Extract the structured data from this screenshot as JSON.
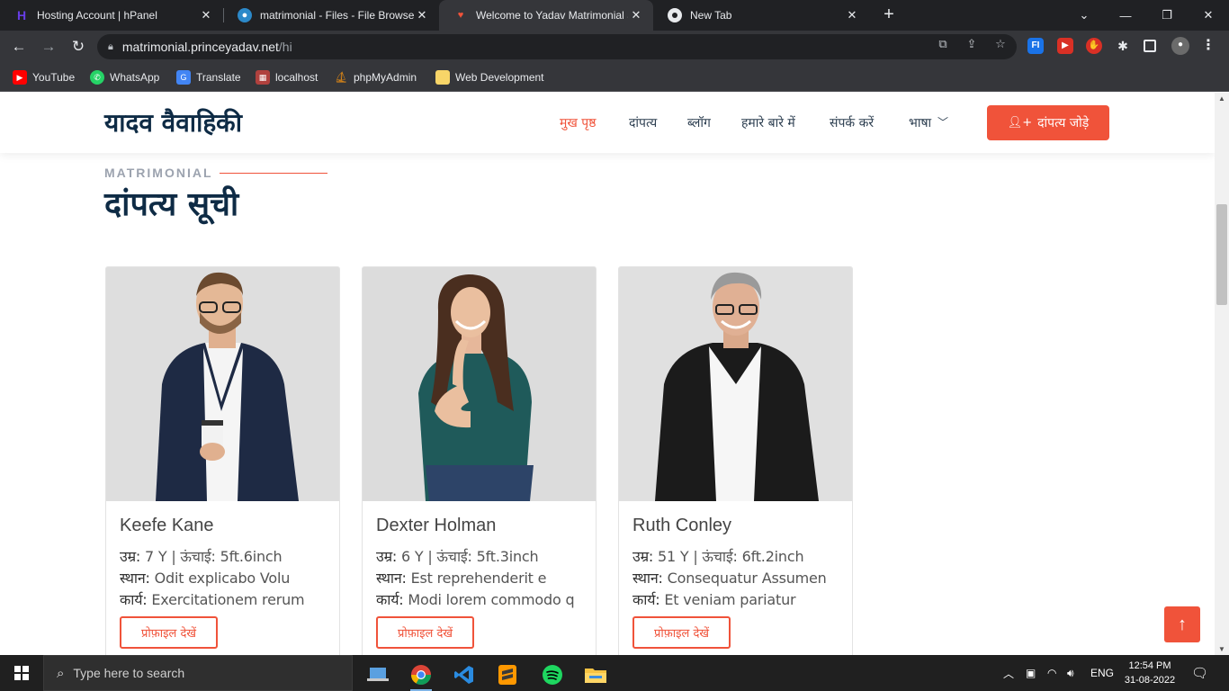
{
  "browser": {
    "tabs": [
      {
        "title": "Hosting Account | hPanel",
        "icon": "hostinger-icon",
        "active": false
      },
      {
        "title": "matrimonial - Files - File Browser",
        "icon": "file-browser-icon",
        "active": false
      },
      {
        "title": "Welcome to Yadav Matrimonial S",
        "icon": "site-icon",
        "active": true
      },
      {
        "title": "New Tab",
        "icon": "chrome-icon",
        "active": false
      }
    ],
    "url_host": "matrimonial.princeyadav.net",
    "url_path": "/hi",
    "bookmarks": [
      {
        "label": "YouTube",
        "icon": "youtube-icon"
      },
      {
        "label": "WhatsApp",
        "icon": "whatsapp-icon"
      },
      {
        "label": "Translate",
        "icon": "translate-icon"
      },
      {
        "label": "localhost",
        "icon": "localhost-icon"
      },
      {
        "label": "phpMyAdmin",
        "icon": "phpmyadmin-icon"
      },
      {
        "label": "Web Development",
        "icon": "folder-icon"
      }
    ]
  },
  "site": {
    "logo": "यादव वैवाहिकी",
    "nav": [
      {
        "label": "मुख पृष्ठ",
        "active": true
      },
      {
        "label": "दांपत्य",
        "active": false
      },
      {
        "label": "ब्लॉग",
        "active": false
      },
      {
        "label": "हमारे बारे में",
        "active": false
      },
      {
        "label": "संपर्क करें",
        "active": false
      },
      {
        "label": "भाषा",
        "active": false
      }
    ],
    "add_button": "दांपत्य जोड़े",
    "accent": "#f0533a",
    "heading_color": "#0e2b45"
  },
  "section": {
    "eyebrow": "MATRIMONIAL",
    "title": "दांपत्य सूची"
  },
  "profiles": [
    {
      "name": "Keefe Kane",
      "line1_label": "उम्र:",
      "line1_value": " 7 Y | ऊंचाई: 5ft.6inch",
      "line2_label": "स्थान:",
      "line2_value": " Odit explicabo Volu",
      "line3_label": "कार्य:",
      "line3_value": " Exercitationem rerum",
      "button": "प्रोफ़ाइल देखें"
    },
    {
      "name": "Dexter Holman",
      "line1_label": "उम्र:",
      "line1_value": " 6 Y | ऊंचाई: 5ft.3inch",
      "line2_label": "स्थान:",
      "line2_value": " Est reprehenderit e",
      "line3_label": "कार्य:",
      "line3_value": " Modi lorem commodo q",
      "button": "प्रोफ़ाइल देखें"
    },
    {
      "name": "Ruth Conley",
      "line1_label": "उम्र:",
      "line1_value": " 51 Y | ऊंचाई: 6ft.2inch",
      "line2_label": "स्थान:",
      "line2_value": " Consequatur Assumen",
      "line3_label": "कार्य:",
      "line3_value": " Et veniam pariatur",
      "button": "प्रोफ़ाइल देखें"
    }
  ],
  "taskbar": {
    "search_placeholder": "Type here to search",
    "apps": [
      "file-explorer-laptop-icon",
      "chrome-icon",
      "vscode-icon",
      "sublime-icon",
      "spotify-icon",
      "folder-icon"
    ],
    "language": "ENG",
    "time": "12:54 PM",
    "date": "31-08-2022"
  }
}
